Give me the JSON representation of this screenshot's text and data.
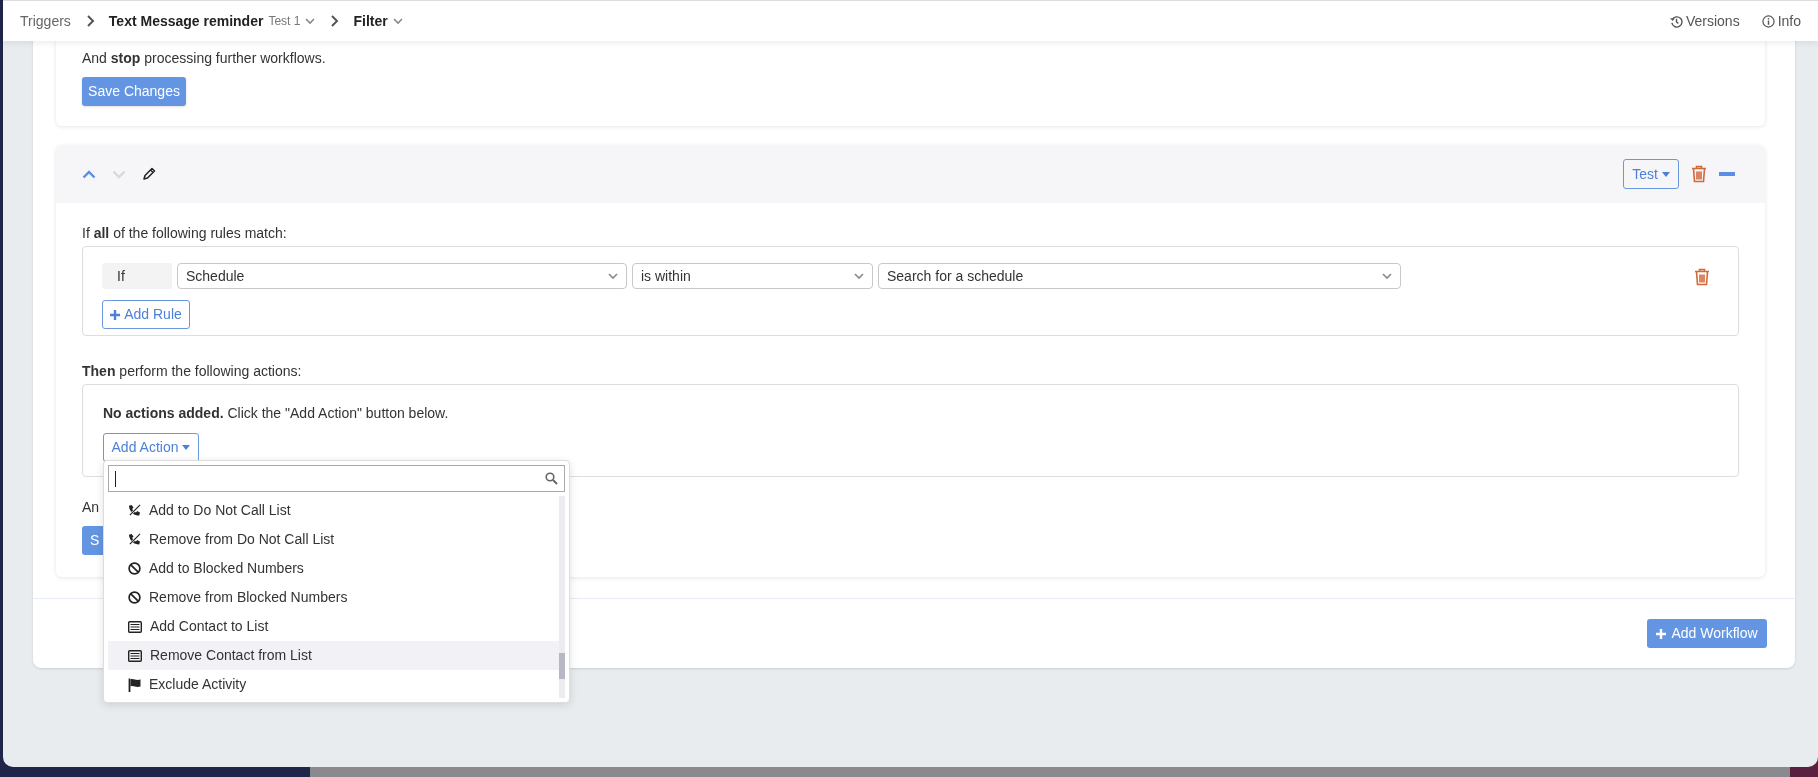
{
  "breadcrumbs": [
    {
      "label": "Triggers",
      "current": false,
      "dropdown": false
    },
    {
      "label": "Text Message reminder",
      "sub": "Test 1",
      "current": true,
      "dropdown": true
    },
    {
      "label": "Filter",
      "current": true,
      "dropdown": true
    }
  ],
  "header_links": [
    {
      "kind": "versions",
      "label": "Versions"
    },
    {
      "kind": "info",
      "label": "Info"
    }
  ],
  "workflow_1": {
    "stop_text": "And **stop** processing further workflows.",
    "save_button": "Save Changes"
  },
  "workflow_2": {
    "move_up": {
      "disabled": false
    },
    "move_down": {
      "disabled": true
    },
    "test_button": "Test",
    "rules_heading": "If **all** of the following rules match:",
    "rules": [
      {
        "prefix": "If",
        "field": "Schedule",
        "operator": "is within",
        "value": "Search for a schedule"
      }
    ],
    "add_rule_button": "Add Rule",
    "actions_heading": "**Then** perform the following actions:",
    "empty_message": "**No actions added.** Click the \"Add Action\" button below.",
    "add_action_button": "Add Action",
    "stop_text": "An",
    "save_button": "S"
  },
  "add_workflow_button": "Add Workflow",
  "action_menu": {
    "items": [
      {
        "kind": "dnc",
        "label": "Add to Do Not Call List",
        "selected": false
      },
      {
        "kind": "dnc",
        "label": "Remove from Do Not Call List",
        "selected": false
      },
      {
        "kind": "blocked",
        "label": "Add to Blocked Numbers",
        "selected": false
      },
      {
        "kind": "blocked",
        "label": "Remove from Blocked Numbers",
        "selected": false
      },
      {
        "kind": "list",
        "label": "Add Contact to List",
        "selected": false
      },
      {
        "kind": "list",
        "label": "Remove Contact from List",
        "selected": true
      },
      {
        "kind": "activity",
        "label": "Exclude Activity",
        "selected": false
      }
    ]
  }
}
